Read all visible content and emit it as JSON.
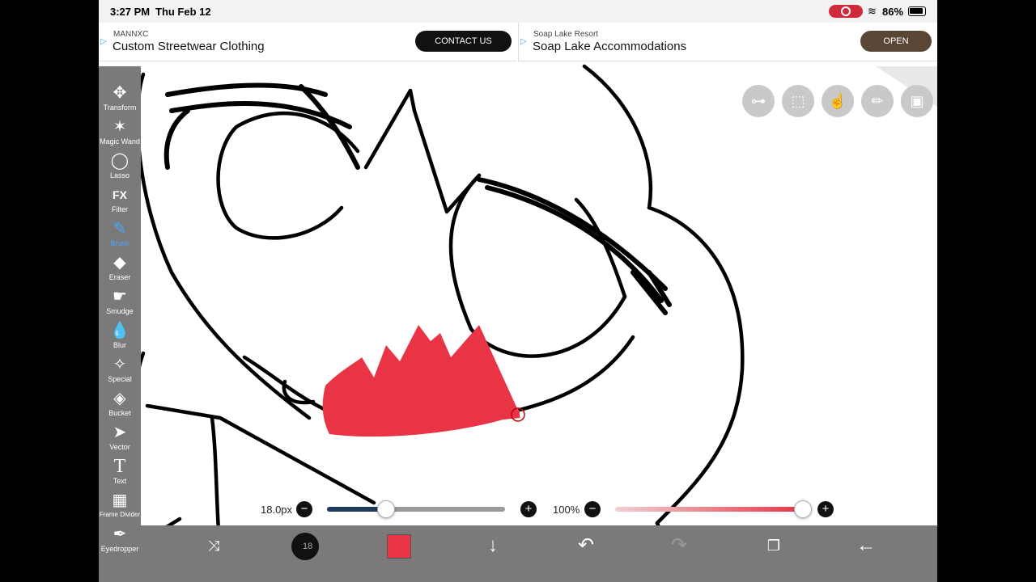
{
  "status_bar": {
    "time": "3:27 PM",
    "date": "Thu Feb 12",
    "battery": "86%"
  },
  "ads": [
    {
      "source": "MANNXC",
      "headline": "Custom Streetwear Clothing",
      "cta": "CONTACT US"
    },
    {
      "source": "Soap Lake Resort",
      "headline": "Soap Lake Accommodations",
      "cta": "OPEN"
    }
  ],
  "toolbar": {
    "tools": [
      {
        "label": "Transform",
        "icon": "✥"
      },
      {
        "label": "Magic Wand",
        "icon": "✶"
      },
      {
        "label": "Lasso",
        "icon": "◯"
      },
      {
        "label": "Filter",
        "icon": "FX"
      },
      {
        "label": "Brush",
        "icon": "✎"
      },
      {
        "label": "Eraser",
        "icon": "◆"
      },
      {
        "label": "Smudge",
        "icon": "☛"
      },
      {
        "label": "Blur",
        "icon": "💧"
      },
      {
        "label": "Special",
        "icon": "✧"
      },
      {
        "label": "Bucket",
        "icon": "◈"
      },
      {
        "label": "Vector",
        "icon": "➤"
      },
      {
        "label": "Text",
        "icon": "T"
      },
      {
        "label": "Frame Divider",
        "icon": "▦"
      },
      {
        "label": "Eyedropper",
        "icon": "✒"
      }
    ],
    "active_tool": "Brush"
  },
  "brush": {
    "size_label": "18.0px",
    "size_fraction": 0.33,
    "opacity_label": "100%",
    "opacity_fraction": 1.0,
    "color": "#e83445",
    "size_badge": "18"
  },
  "colors": {
    "accent": "#4aa6ff",
    "brush_red": "#e83445",
    "toolbar_gray": "#7a7a7a",
    "size_track": "#1e3a5f"
  }
}
